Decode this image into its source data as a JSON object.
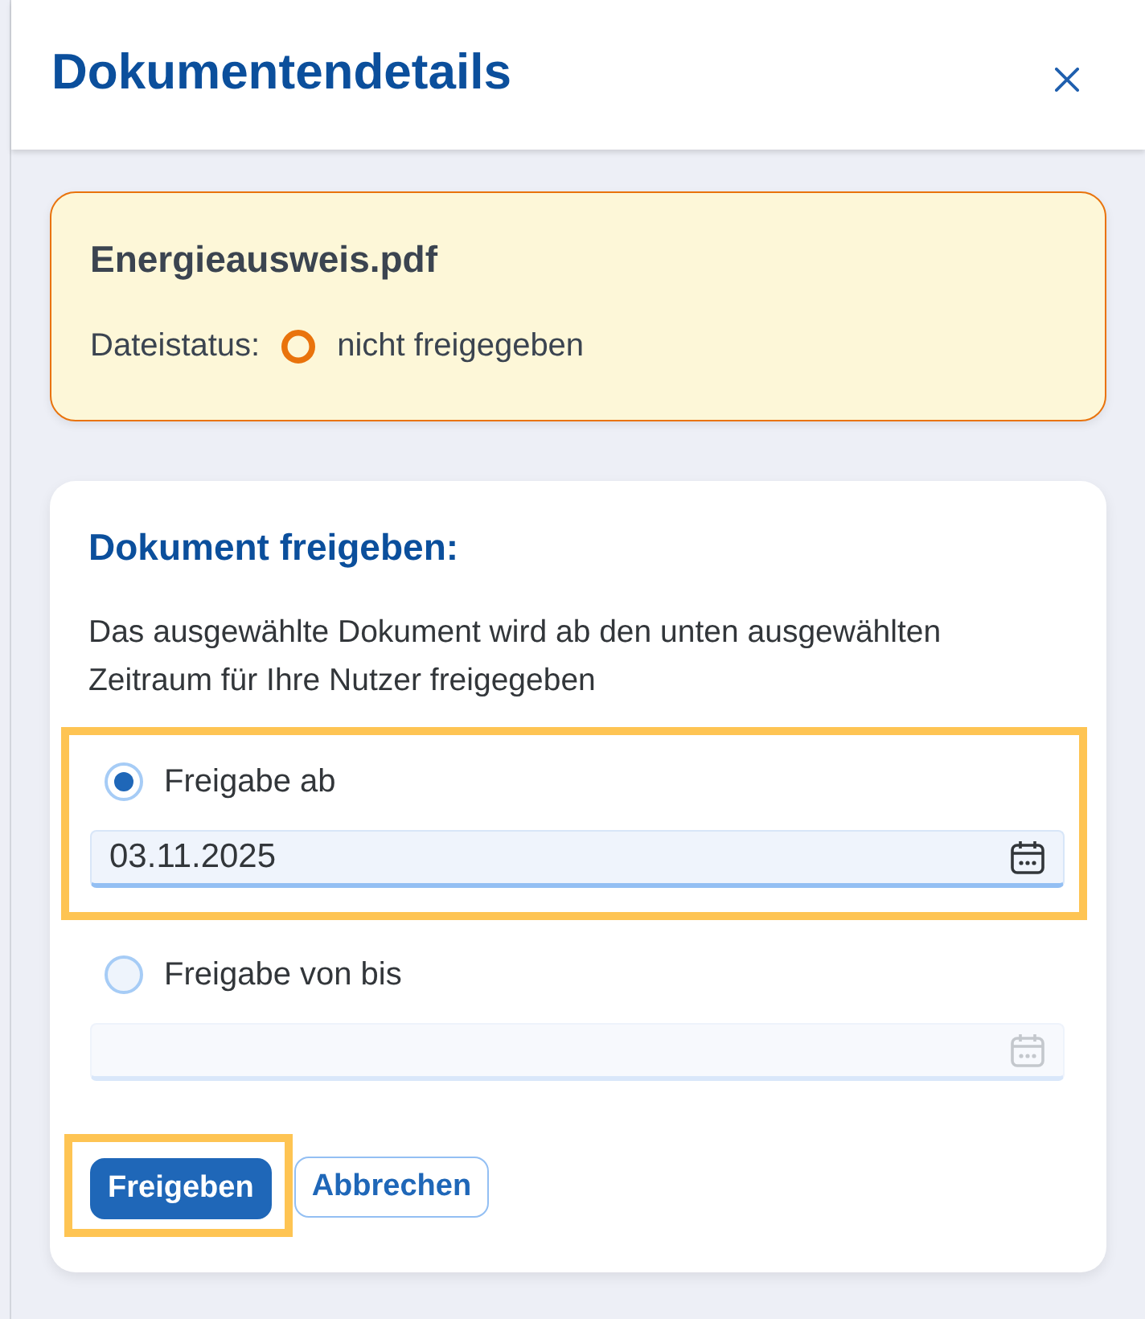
{
  "panel": {
    "title": "Dokumentendetails"
  },
  "file_card": {
    "name": "Energieausweis.pdf",
    "status_label": "Dateistatus:",
    "status": "nicht freigegeben",
    "released": false
  },
  "release_form": {
    "heading": "Dokument freigeben:",
    "description": "Das ausgewählte Dokument wird ab den unten ausgewählten Zeitraum für Ihre Nutzer freigegeben",
    "options": [
      {
        "label": "Freigabe ab",
        "selected": true,
        "highlighted": true,
        "date_field": {
          "value": "03.11.2025",
          "disabled": false
        }
      },
      {
        "label": "Freigabe von bis",
        "selected": false,
        "highlighted": false,
        "date_field": {
          "disabled": true
        }
      }
    ],
    "buttons": [
      {
        "label": "Freigeben",
        "kind": "primary",
        "highlighted": true
      },
      {
        "label": "Abbrechen",
        "kind": "secondary",
        "highlighted": false
      }
    ]
  }
}
